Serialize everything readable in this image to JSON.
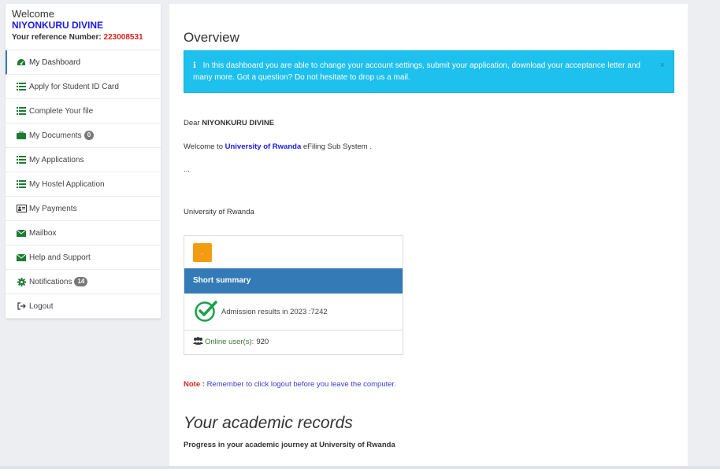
{
  "sidebar": {
    "welcome": "Welcome",
    "name": "NIYONKURU DIVINE",
    "ref_label": "Your reference Number:",
    "ref_number": "223008531",
    "items": [
      {
        "label": "My Dashboard",
        "icon": "dashboard-icon"
      },
      {
        "label": "Apply for Student ID Card",
        "icon": "list-icon"
      },
      {
        "label": "Complete Your file",
        "icon": "list-icon"
      },
      {
        "label": "My Documents",
        "icon": "briefcase-icon",
        "badge": "0"
      },
      {
        "label": "My Applications",
        "icon": "list-icon"
      },
      {
        "label": "My Hostel Application",
        "icon": "list-icon"
      },
      {
        "label": "My Payments",
        "icon": "id-card-icon"
      },
      {
        "label": "Mailbox",
        "icon": "envelope-icon"
      },
      {
        "label": "Help and Support",
        "icon": "envelope-icon"
      },
      {
        "label": "Notifications",
        "icon": "gear-icon",
        "badge": "14"
      },
      {
        "label": "Logout",
        "icon": "sign-out-icon"
      }
    ]
  },
  "main": {
    "title": "Overview",
    "alert": {
      "icon": "ℹ",
      "text": "In this dashboard you are able to change your account settings, submit your application, download your acceptance letter and many more. Got a question? Do not hesitate to drop us a mail.",
      "close": "×"
    },
    "dear": "Dear",
    "dear_name": "NIYONKURU DIVINE",
    "welcome_prefix": "Welcome to",
    "welcome_link": "University of Rwanda",
    "welcome_suffix": "eFiling Sub System .",
    "ellipsis": "...",
    "signature": "University of Rwanda",
    "summary": {
      "button": ".",
      "heading": "Short summary",
      "admission": "Admission results in 2023 :7242",
      "online_label": "Online user(s):",
      "online_count": "920"
    },
    "note_label": "Note :",
    "note_text": "Remember to click logout before you leave the computer.",
    "records_title": "Your academic records",
    "records_sub": "Progress in your academic journey at University of Rwanda"
  },
  "colors": {
    "brand_blue": "#1a1ae6",
    "alert_cyan": "#1ec0ed",
    "summary_blue": "#337ab7",
    "icon_green": "#1e7b34",
    "note_red": "#e0201a",
    "orange": "#f39c12"
  }
}
